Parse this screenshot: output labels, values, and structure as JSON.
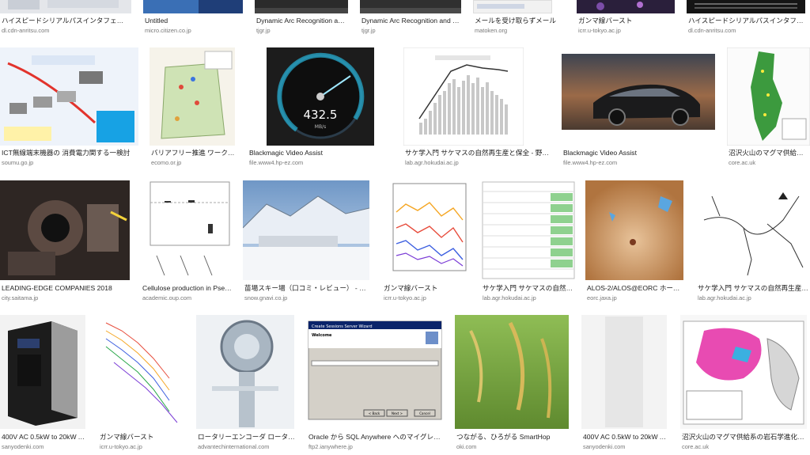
{
  "rows": [
    {
      "items": [
        {
          "title": "ハイスピードシリアルパスインタフェース…",
          "source": "dl.cdn-anritsu.com",
          "bg": "#e4e6ea"
        },
        {
          "title": "Untitled",
          "source": "micro.citizen.co.jp",
          "bg": "#3a6fb5"
        },
        {
          "title": "Dynamic Arc Recognition an…",
          "source": "tjgr.jp",
          "bg": "#2b2b2b"
        },
        {
          "title": "Dynamic Arc Recognition and T…",
          "source": "tjgr.jp",
          "bg": "#303030"
        },
        {
          "title": "メールを受け取らずメール",
          "source": "matoken.org",
          "bg": "#f1f1f1"
        },
        {
          "title": "ガンマ線バースト",
          "source": "icrr.u-tokyo.ac.jp",
          "bg": "#2a1f3b"
        },
        {
          "title": "ハイスピードシリアルパスインタフェー…",
          "source": "dl.cdn-anritsu.com",
          "bg": "#151515"
        }
      ]
    },
    {
      "items": [
        {
          "title": "ICT無線端末機器の 消費電力関する一検討",
          "source": "soumu.go.jp",
          "bg": "#f3f6fa"
        },
        {
          "title": "バリアフリー推進 ワーク…",
          "source": "ecomo.or.jp",
          "bg": "#f5f2e8"
        },
        {
          "title": "Blackmagic Video Assist",
          "source": "file.www4.hp-ez.com",
          "bg": "#1c1c1c",
          "readout": "432.5",
          "unit": "MB/s"
        },
        {
          "title": "サケ学入門 サケマスの自然再生産と保全 - 野生…",
          "source": "lab.agr.hokudai.ac.jp",
          "bg": "#fafafa"
        },
        {
          "title": "Blackmagic Video Assist",
          "source": "file.www4.hp-ez.com",
          "bg": "#2d2a28"
        },
        {
          "title": "沼沢火山のマグマ供給系の…",
          "source": "core.ac.uk",
          "bg": "#f4f4f4"
        }
      ]
    },
    {
      "items": [
        {
          "title": "LEADING-EDGE COMPANIES 2018",
          "source": "city.saitama.jp",
          "bg": "#3b3330"
        },
        {
          "title": "Cellulose production in Pseu…",
          "source": "academic.oup.com",
          "bg": "#ffffff"
        },
        {
          "title": "苗場スキー場（口コミ・レビュー） - ス…",
          "source": "snow.gnavi.co.jp",
          "bg": "#7fa3c9"
        },
        {
          "title": "ガンマ線バースト",
          "source": "icrr.u-tokyo.ac.jp",
          "bg": "#ffffff"
        },
        {
          "title": "サケ学入門 サケマスの自然…",
          "source": "lab.agr.hokudai.ac.jp",
          "bg": "#ffffff"
        },
        {
          "title": "ALOS-2/ALOS@EORC ホーム…",
          "source": "eorc.jaxa.jp",
          "bg": "#c7915a"
        },
        {
          "title": "サケ学入門 サケマスの自然再生産と保全…",
          "source": "lab.agr.hokudai.ac.jp",
          "bg": "#ffffff"
        }
      ]
    },
    {
      "items": [
        {
          "title": "400V AC 0.5kW to 20kW A…",
          "source": "sanyodenki.com",
          "bg": "#eeeeee"
        },
        {
          "title": "ガンマ線バースト",
          "source": "icrr.u-tokyo.ac.jp",
          "bg": "#ffffff"
        },
        {
          "title": "ロータリーエンコーダ ロータ…",
          "source": "advantechinternational.com",
          "bg": "#e9ecef"
        },
        {
          "title": "Oracle から SQL Anywhere へのマイグレー…",
          "source": "ftp2.ianywhere.jp",
          "bg": "#d4d0c8",
          "dialog": "Create Sessions Server Wizard",
          "heading": "Welcome",
          "btn_back": "< Back",
          "btn_next": "Next >",
          "btn_cancel": "Cancel"
        },
        {
          "title": "つながる、ひろがる SmartHop",
          "source": "oki.com",
          "bg": "#7ea64a"
        },
        {
          "title": "400V AC 0.5kW to 20kW A…",
          "source": "sanyodenki.com",
          "bg": "#f3f3f3"
        },
        {
          "title": "沼沢火山のマグマ供給系の岩石学進化とカ…",
          "source": "core.ac.uk",
          "bg": "#f7f7f7"
        }
      ]
    }
  ]
}
